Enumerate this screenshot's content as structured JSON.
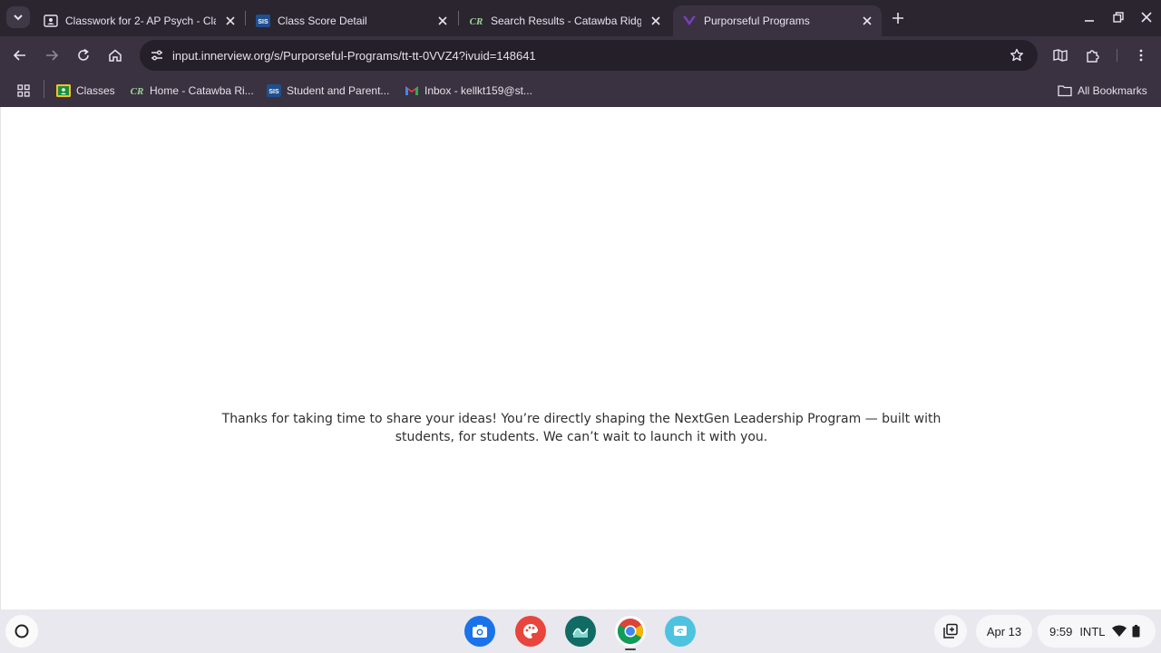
{
  "browser": {
    "tabs": [
      {
        "title": "Classwork for 2- AP Psych - Cla",
        "icon": "google-classroom-icon"
      },
      {
        "title": "Class Score Detail",
        "icon": "sis-icon"
      },
      {
        "title": "Search Results - Catawba Ridge",
        "icon": "catawba-ridge-icon"
      },
      {
        "title": "Purporseful Programs",
        "icon": "innerview-icon",
        "active": true
      }
    ],
    "url": "input.innerview.org/s/Purporseful-Programs/tt-tt-0VVZ4?ivuid=148641",
    "bookmarks": [
      {
        "label": "Classes",
        "icon": "google-classroom-icon"
      },
      {
        "label": "Home - Catawba Ri...",
        "icon": "catawba-ridge-icon"
      },
      {
        "label": "Student and Parent...",
        "icon": "sis-icon"
      },
      {
        "label": "Inbox - kellkt159@st...",
        "icon": "gmail-icon"
      }
    ],
    "all_bookmarks": "All Bookmarks"
  },
  "page": {
    "message": "Thanks for taking  time to share your ideas! You’re directly shaping the NextGen Leadership Program — built with students, for students. We can’t wait to launch it with you."
  },
  "shelf": {
    "apps": [
      "camera-app-icon",
      "canvas-app-icon",
      "sheets-wave-app-icon",
      "chrome-app-icon",
      "screencast-app-icon"
    ],
    "date": "Apr 13",
    "time": "9:59",
    "input_method": "INTL"
  },
  "colors": {
    "tabstrip": "#2b2530",
    "toolbar": "#3a3240",
    "omnibox": "#241f29",
    "shelf": "#e8e8ee"
  }
}
